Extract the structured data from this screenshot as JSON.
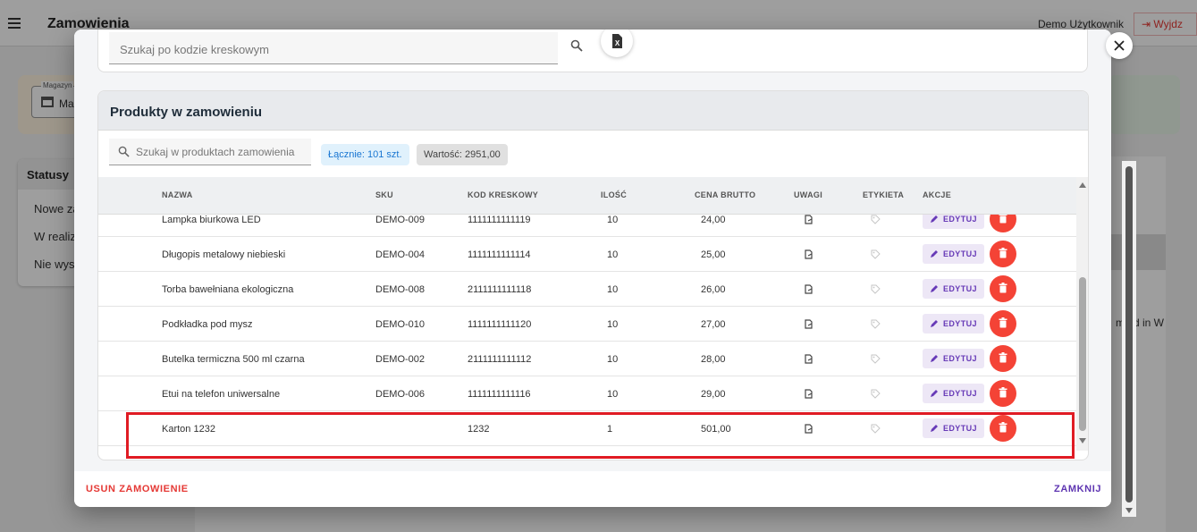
{
  "app": {
    "title": "Zamowienia",
    "user": "Demo Użytkownik",
    "logout_label": "Wyjdz",
    "warehouse_label": "Magazyn",
    "warehouse_value": "Ma",
    "statuses_title": "Statusy",
    "statuses": [
      "Nowe za",
      "W realiz",
      "Nie wysy"
    ],
    "right_text": "ma d in W"
  },
  "barcode": {
    "placeholder": "Szukaj po kodzie kreskowym"
  },
  "products": {
    "title": "Produkty w zamowieniu",
    "search_placeholder": "Szukaj w produktach zamowienia",
    "total_chip": "Łącznie: 101 szt.",
    "value_chip": "Wartość: 2951,00",
    "columns": {
      "name": "NAZWA",
      "sku": "SKU",
      "barcode": "KOD KRESKOWY",
      "qty": "ILOŚĆ",
      "price": "CENA BRUTTO",
      "notes": "UWAGI",
      "label": "ETYKIETA",
      "actions": "AKCJE"
    },
    "edit_label": "EDYTUJ",
    "rows": [
      {
        "name": "Lampka biurkowa LED",
        "sku": "DEMO-009",
        "barcode": "1111111111119",
        "qty": "10",
        "price": "24,00"
      },
      {
        "name": "Długopis metalowy niebieski",
        "sku": "DEMO-004",
        "barcode": "1111111111114",
        "qty": "10",
        "price": "25,00"
      },
      {
        "name": "Torba bawełniana ekologiczna",
        "sku": "DEMO-008",
        "barcode": "2111111111118",
        "qty": "10",
        "price": "26,00"
      },
      {
        "name": "Podkładka pod mysz",
        "sku": "DEMO-010",
        "barcode": "1111111111120",
        "qty": "10",
        "price": "27,00"
      },
      {
        "name": "Butelka termiczna 500 ml czarna",
        "sku": "DEMO-002",
        "barcode": "2111111111112",
        "qty": "10",
        "price": "28,00"
      },
      {
        "name": "Etui na telefon uniwersalne",
        "sku": "DEMO-006",
        "barcode": "1111111111116",
        "qty": "10",
        "price": "29,00"
      },
      {
        "name": "Karton 1232",
        "sku": "",
        "barcode": "1232",
        "qty": "1",
        "price": "501,00"
      }
    ]
  },
  "footer": {
    "delete_order": "USUN ZAMOWIENIE",
    "close": "ZAMKNIJ"
  },
  "colors": {
    "accent": "#673ab7",
    "danger": "#f44336",
    "highlight": "#e01b24",
    "chip_blue": "#1976d2"
  }
}
